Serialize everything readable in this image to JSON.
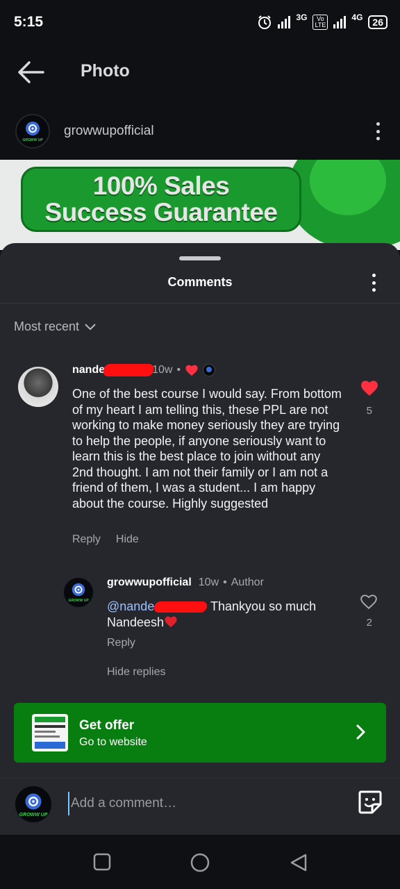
{
  "status_bar": {
    "time": "5:15",
    "net1": "3G",
    "volte": "Vo LTE",
    "net2": "4G",
    "battery": "26"
  },
  "header": {
    "title": "Photo"
  },
  "post": {
    "username": "growwupofficial"
  },
  "banner": {
    "line1": "100% Sales",
    "line2": "Success Guarantee"
  },
  "sheet": {
    "title": "Comments",
    "sort_label": "Most recent"
  },
  "logo": {
    "caption": "GROWW UP"
  },
  "comment": {
    "username": "nande",
    "time": "10w",
    "text": "One of the best course I would say. From bottom of my heart I am telling this, these PPL are not working to make money seriously they are trying to help the people, if anyone seriously want to learn this is the best place to join without any 2nd thought.  I am not their family or I am not a friend of them, I was a student... I am happy about the course. Highly suggested",
    "like_count": "5",
    "reply_label": "Reply",
    "hide_label": "Hide"
  },
  "reply": {
    "username": "growwupofficial",
    "time": "10w",
    "author_label": "Author",
    "mention": "@nande",
    "text_tail": "Thankyou so much",
    "text_line2": "Nandeesh",
    "like_count": "2",
    "reply_label": "Reply"
  },
  "hide_replies_label": "Hide replies",
  "offer": {
    "title": "Get offer",
    "subtitle": "Go to website"
  },
  "composer": {
    "placeholder": "Add a comment…"
  },
  "colors": {
    "sheet_bg": "#25272d",
    "offer_green": "#087e11",
    "like_red": "#ff3040"
  }
}
